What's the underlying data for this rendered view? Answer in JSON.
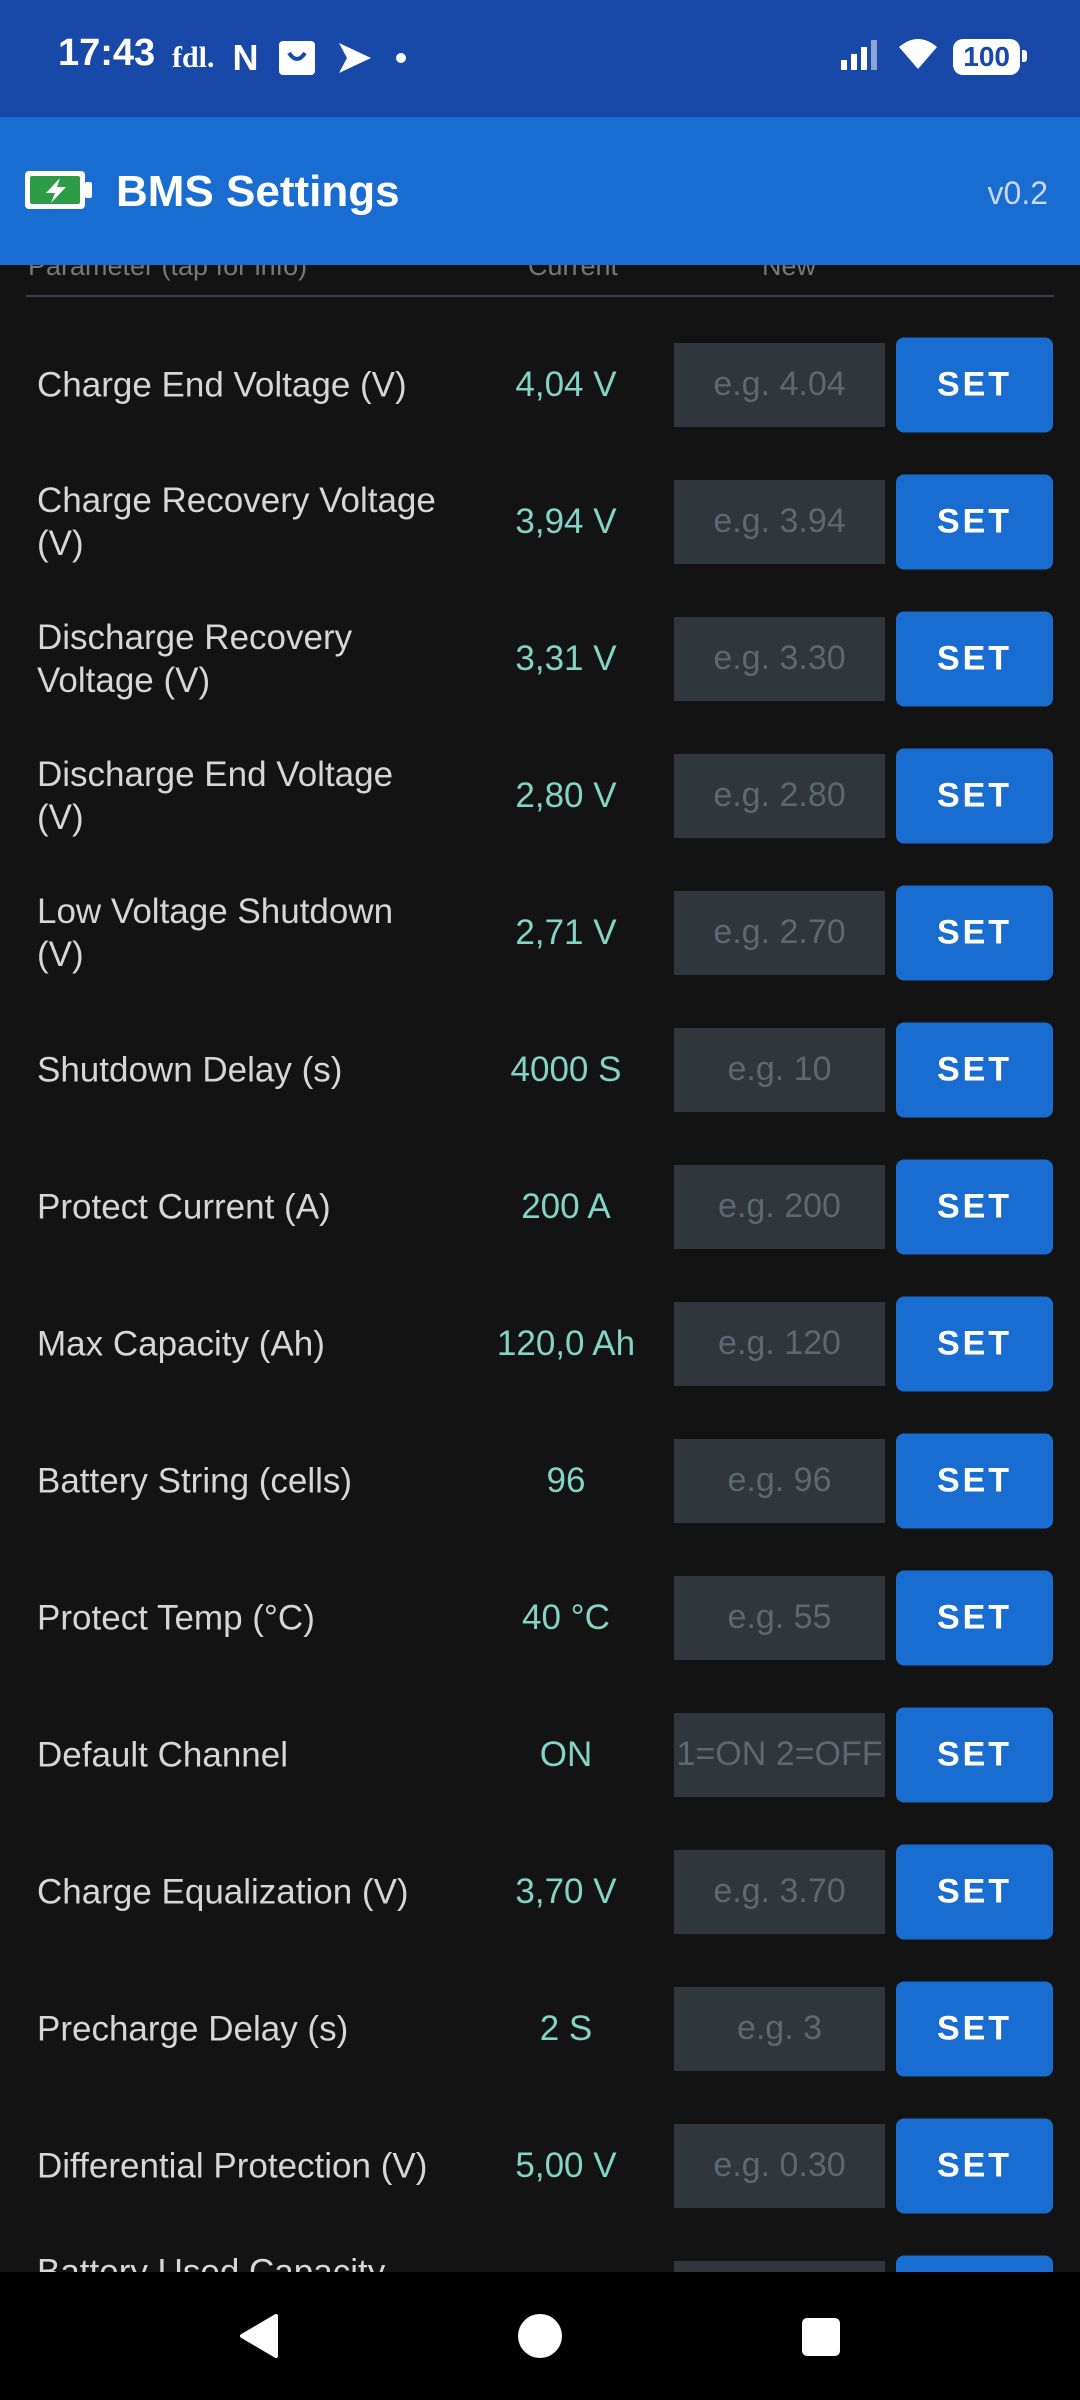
{
  "status_bar": {
    "time": "17:43",
    "notif_fdl": "fdl.",
    "notif_n": "N",
    "battery_level": "100"
  },
  "app_bar": {
    "title": "BMS Settings",
    "version": "v0.2"
  },
  "columns": {
    "parameter": "Parameter (tap for info)",
    "current": "Current",
    "new": "New"
  },
  "set_label": "SET",
  "rows": [
    {
      "label": "Charge End Voltage (V)",
      "current": "4,04 V",
      "placeholder": "e.g. 4.04"
    },
    {
      "label": "Charge Recovery Voltage (V)",
      "current": "3,94 V",
      "placeholder": "e.g. 3.94"
    },
    {
      "label": "Discharge Recovery Voltage (V)",
      "current": "3,31 V",
      "placeholder": "e.g. 3.30"
    },
    {
      "label": "Discharge End Voltage (V)",
      "current": "2,80 V",
      "placeholder": "e.g. 2.80"
    },
    {
      "label": "Low Voltage Shutdown (V)",
      "current": "2,71 V",
      "placeholder": "e.g. 2.70"
    },
    {
      "label": "Shutdown Delay (s)",
      "current": "4000 S",
      "placeholder": "e.g. 10"
    },
    {
      "label": "Protect Current (A)",
      "current": "200 A",
      "placeholder": "e.g. 200"
    },
    {
      "label": "Max Capacity (Ah)",
      "current": "120,0 Ah",
      "placeholder": "e.g. 120"
    },
    {
      "label": "Battery String (cells)",
      "current": "96",
      "placeholder": "e.g. 96"
    },
    {
      "label": "Protect Temp (°C)",
      "current": "40 °C",
      "placeholder": "e.g. 55"
    },
    {
      "label": "Default Channel",
      "current": "ON",
      "placeholder": "1=ON 2=OFF"
    },
    {
      "label": "Charge Equalization (V)",
      "current": "3,70 V",
      "placeholder": "e.g. 3.70"
    },
    {
      "label": "Precharge Delay (s)",
      "current": "2 S",
      "placeholder": "e.g. 3"
    },
    {
      "label": "Differential Protection (V)",
      "current": "5,00 V",
      "placeholder": "e.g. 0.30"
    },
    {
      "label": "Battery Used Capacity",
      "current": "",
      "placeholder": ""
    }
  ]
}
